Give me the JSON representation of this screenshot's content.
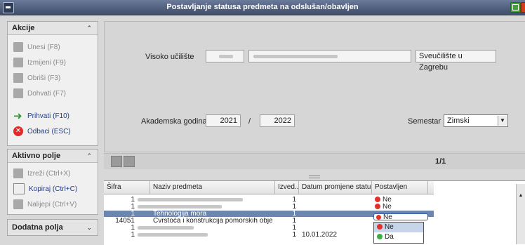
{
  "window": {
    "title": "Postavljanje statusa predmeta na odslušan/obavljen"
  },
  "akcije": {
    "title": "Akcije",
    "items": [
      {
        "label": "Unesi (F8)"
      },
      {
        "label": "Izmijeni (F9)"
      },
      {
        "label": "Obriši (F3)"
      },
      {
        "label": "Dohvati (F7)"
      },
      {
        "label": "Prihvati (F10)"
      },
      {
        "label": "Odbaci (ESC)"
      }
    ]
  },
  "aktivno_polje": {
    "title": "Aktivno polje",
    "items": [
      {
        "label": "Izreži (Ctrl+X)"
      },
      {
        "label": "Kopiraj (Ctrl+C)"
      },
      {
        "label": "Nalijepi (Ctrl+V)"
      }
    ]
  },
  "dodatna_polja": {
    "title": "Dodatna polja"
  },
  "form": {
    "visoko_uciliste_label": "Visoko učilište",
    "visoko_uciliste_value": "Sveučilište u Zagrebu",
    "akademska_godina_label": "Akademska godina",
    "year_from": "2021",
    "separator": "/",
    "year_to": "2022",
    "semestar_label": "Semestar",
    "semestar_value": "Zimski"
  },
  "pager": {
    "text": "1/1"
  },
  "table": {
    "columns": [
      "Šifra",
      "Naziv predmeta",
      "Izved...",
      "Datum promjene statu...",
      "Postavljen"
    ],
    "rows": [
      {
        "sifra": "1",
        "naziv": "",
        "izvedba": "1",
        "datum": "",
        "postavljen": "Ne"
      },
      {
        "sifra": "1",
        "naziv": "",
        "izvedba": "1",
        "datum": "",
        "postavljen": "Ne"
      },
      {
        "sifra": "1",
        "naziv": "Tehnologija mora",
        "izvedba": "1",
        "datum": "",
        "postavljen": "Ne"
      },
      {
        "sifra": "14051",
        "naziv": "Čvrstoća i konstrukcija pomorskih objek",
        "izvedba": "1",
        "datum": "",
        "postavljen": ""
      },
      {
        "sifra": "1",
        "naziv": "",
        "izvedba": "1",
        "datum": "",
        "postavljen": ""
      },
      {
        "sifra": "1",
        "naziv": "",
        "izvedba": "1",
        "datum": "10.01.2022",
        "postavljen": "Da"
      }
    ]
  },
  "dropdown": {
    "options": [
      "Ne",
      "Da"
    ]
  },
  "colors": {
    "titlebar": "#3c4a66",
    "selected_row": "#6d86ad",
    "no_icon": "#e0312b",
    "yes_icon": "#3eae3e"
  }
}
